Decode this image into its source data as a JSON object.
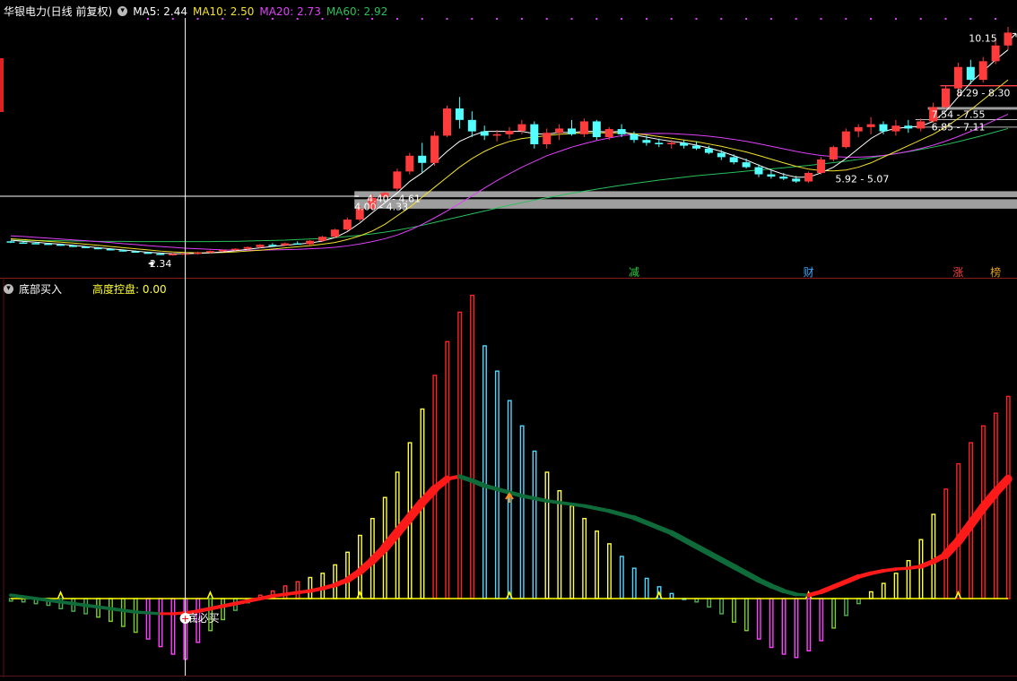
{
  "header": {
    "title": "华银电力(日线 前复权)",
    "ma5_label": "MA5:",
    "ma5_value": "2.44",
    "ma10_label": "MA10:",
    "ma10_value": "2.50",
    "ma20_label": "MA20:",
    "ma20_value": "2.73",
    "ma60_label": "MA60:",
    "ma60_value": "2.92"
  },
  "indicator_header": {
    "name": "底部买入",
    "param_label": "高度控盘:",
    "param_value": "0.00"
  },
  "price_annotations": [
    {
      "text": "10.15"
    },
    {
      "text": "8.29 - 8.30"
    },
    {
      "text": "7.54 - 7.55"
    },
    {
      "text": "6.85 - 7.11"
    },
    {
      "text": "5.92 - 5.07"
    },
    {
      "text": "4.40 - 4.61"
    },
    {
      "text": "4.00 - 4.33"
    },
    {
      "text": "2.34"
    }
  ],
  "event_tags": [
    {
      "text": "减",
      "color": "#2ecc40"
    },
    {
      "text": "财",
      "color": "#3fa7ff"
    },
    {
      "text": "涨",
      "color": "#ff4040"
    },
    {
      "text": "榜",
      "color": "#e0a020"
    }
  ],
  "indicator_markers": {
    "buy_label": "底必买",
    "buy_symbol": "+"
  },
  "colors": {
    "up": "#ff3b3b",
    "down": "#54ffff",
    "ma5": "#ffffff",
    "ma10": "#f2e12b",
    "ma20": "#e040fb",
    "ma60": "#28c05a",
    "crosshair": "#ffffff",
    "zone": "#9e9e9e",
    "ribbon_up": "#ff1a1a",
    "ribbon_down": "#0f6b3a",
    "baseline": "#ffff00"
  },
  "chart_data": {
    "type": "candlestick",
    "candles": [
      [
        2.86,
        2.88,
        2.8,
        2.82
      ],
      [
        2.82,
        2.85,
        2.78,
        2.8
      ],
      [
        2.8,
        2.84,
        2.77,
        2.78
      ],
      [
        2.78,
        2.8,
        2.74,
        2.75
      ],
      [
        2.75,
        2.78,
        2.7,
        2.71
      ],
      [
        2.71,
        2.74,
        2.66,
        2.67
      ],
      [
        2.67,
        2.7,
        2.62,
        2.63
      ],
      [
        2.63,
        2.66,
        2.58,
        2.59
      ],
      [
        2.59,
        2.62,
        2.54,
        2.55
      ],
      [
        2.55,
        2.58,
        2.5,
        2.51
      ],
      [
        2.51,
        2.54,
        2.46,
        2.47
      ],
      [
        2.47,
        2.5,
        2.42,
        2.43
      ],
      [
        2.43,
        2.47,
        2.38,
        2.4
      ],
      [
        2.4,
        2.45,
        2.36,
        2.42
      ],
      [
        2.42,
        2.48,
        2.34,
        2.44
      ],
      [
        2.44,
        2.5,
        2.4,
        2.47
      ],
      [
        2.47,
        2.54,
        2.44,
        2.52
      ],
      [
        2.52,
        2.58,
        2.49,
        2.56
      ],
      [
        2.56,
        2.62,
        2.52,
        2.6
      ],
      [
        2.6,
        2.68,
        2.57,
        2.66
      ],
      [
        2.66,
        2.76,
        2.62,
        2.74
      ],
      [
        2.74,
        2.8,
        2.68,
        2.72
      ],
      [
        2.72,
        2.82,
        2.69,
        2.79
      ],
      [
        2.79,
        2.86,
        2.74,
        2.76
      ],
      [
        2.76,
        2.9,
        2.72,
        2.88
      ],
      [
        2.88,
        3.05,
        2.84,
        3.02
      ],
      [
        3.02,
        3.3,
        2.98,
        3.27
      ],
      [
        3.27,
        3.7,
        3.22,
        3.62
      ],
      [
        3.62,
        4.1,
        3.55,
        4.0
      ],
      [
        4.0,
        4.5,
        3.95,
        4.38
      ],
      [
        4.42,
        4.6,
        4.38,
        4.55
      ],
      [
        4.7,
        5.4,
        4.62,
        5.3
      ],
      [
        5.3,
        5.95,
        5.2,
        5.85
      ],
      [
        5.85,
        6.3,
        5.25,
        5.6
      ],
      [
        5.6,
        6.7,
        5.5,
        6.55
      ],
      [
        6.55,
        7.6,
        6.5,
        7.5
      ],
      [
        7.5,
        7.9,
        6.8,
        7.1
      ],
      [
        7.1,
        7.4,
        6.5,
        6.7
      ],
      [
        6.7,
        6.9,
        6.4,
        6.55
      ],
      [
        6.55,
        6.75,
        6.35,
        6.6
      ],
      [
        6.6,
        6.85,
        6.45,
        6.72
      ],
      [
        6.72,
        7.1,
        6.6,
        6.95
      ],
      [
        6.95,
        7.05,
        6.1,
        6.25
      ],
      [
        6.25,
        6.8,
        6.1,
        6.65
      ],
      [
        6.65,
        6.95,
        6.4,
        6.8
      ],
      [
        6.8,
        7.1,
        6.55,
        6.6
      ],
      [
        6.6,
        7.15,
        6.5,
        7.05
      ],
      [
        7.05,
        7.1,
        6.4,
        6.5
      ],
      [
        6.5,
        6.85,
        6.4,
        6.78
      ],
      [
        6.78,
        6.95,
        6.5,
        6.6
      ],
      [
        6.6,
        6.7,
        6.3,
        6.4
      ],
      [
        6.4,
        6.55,
        6.2,
        6.3
      ],
      [
        6.3,
        6.45,
        6.15,
        6.25
      ],
      [
        6.25,
        6.4,
        6.1,
        6.3
      ],
      [
        6.3,
        6.4,
        6.1,
        6.2
      ],
      [
        6.2,
        6.35,
        6.05,
        6.1
      ],
      [
        6.1,
        6.2,
        5.9,
        5.95
      ],
      [
        5.95,
        6.05,
        5.7,
        5.8
      ],
      [
        5.8,
        5.9,
        5.55,
        5.62
      ],
      [
        5.62,
        5.75,
        5.4,
        5.45
      ],
      [
        5.45,
        5.55,
        5.1,
        5.2
      ],
      [
        5.2,
        5.35,
        5.05,
        5.12
      ],
      [
        5.12,
        5.25,
        5.0,
        5.05
      ],
      [
        5.05,
        5.15,
        4.9,
        4.95
      ],
      [
        4.95,
        5.3,
        4.9,
        5.25
      ],
      [
        5.25,
        5.8,
        5.2,
        5.72
      ],
      [
        5.72,
        6.2,
        5.65,
        6.15
      ],
      [
        6.15,
        6.8,
        6.1,
        6.7
      ],
      [
        6.7,
        6.95,
        6.5,
        6.85
      ],
      [
        6.85,
        7.2,
        6.6,
        6.95
      ],
      [
        6.95,
        7.05,
        6.6,
        6.7
      ],
      [
        6.7,
        7.1,
        6.55,
        6.9
      ],
      [
        6.9,
        7.1,
        6.65,
        6.8
      ],
      [
        6.8,
        7.15,
        6.7,
        7.05
      ],
      [
        7.05,
        7.7,
        7.0,
        7.55
      ],
      [
        7.55,
        8.3,
        7.5,
        8.2
      ],
      [
        8.2,
        9.1,
        7.9,
        8.95
      ],
      [
        8.95,
        9.2,
        8.35,
        8.5
      ],
      [
        8.5,
        9.3,
        8.4,
        9.15
      ],
      [
        9.15,
        9.9,
        9.05,
        9.7
      ],
      [
        9.7,
        10.35,
        9.55,
        10.15
      ]
    ],
    "ma5": [
      2.9,
      2.86,
      2.83,
      2.79,
      2.76,
      2.72,
      2.68,
      2.64,
      2.6,
      2.56,
      2.52,
      2.48,
      2.45,
      2.43,
      2.43,
      2.44,
      2.46,
      2.49,
      2.53,
      2.58,
      2.63,
      2.68,
      2.72,
      2.76,
      2.8,
      2.87,
      2.99,
      3.2,
      3.5,
      3.86,
      4.2,
      4.55,
      4.95,
      5.25,
      5.6,
      6.0,
      6.35,
      6.55,
      6.7,
      6.7,
      6.7,
      6.7,
      6.62,
      6.6,
      6.67,
      6.66,
      6.7,
      6.7,
      6.68,
      6.7,
      6.58,
      6.5,
      6.42,
      6.35,
      6.3,
      6.22,
      6.12,
      6.0,
      5.85,
      5.7,
      5.52,
      5.35,
      5.2,
      5.1,
      5.1,
      5.25,
      5.45,
      5.75,
      6.1,
      6.45,
      6.7,
      6.8,
      6.85,
      6.88,
      7.05,
      7.4,
      7.9,
      8.4,
      8.8,
      9.2,
      9.55
    ],
    "ma10": [
      2.95,
      2.92,
      2.89,
      2.86,
      2.83,
      2.8,
      2.76,
      2.72,
      2.68,
      2.64,
      2.6,
      2.56,
      2.52,
      2.49,
      2.47,
      2.46,
      2.46,
      2.47,
      2.49,
      2.52,
      2.55,
      2.59,
      2.63,
      2.67,
      2.71,
      2.76,
      2.82,
      2.92,
      3.05,
      3.22,
      3.45,
      3.75,
      4.05,
      4.4,
      4.75,
      5.1,
      5.45,
      5.75,
      6.0,
      6.2,
      6.35,
      6.45,
      6.5,
      6.55,
      6.6,
      6.62,
      6.65,
      6.65,
      6.65,
      6.65,
      6.62,
      6.58,
      6.52,
      6.46,
      6.4,
      6.34,
      6.26,
      6.18,
      6.08,
      5.98,
      5.86,
      5.73,
      5.6,
      5.48,
      5.38,
      5.33,
      5.32,
      5.35,
      5.45,
      5.6,
      5.8,
      6.0,
      6.2,
      6.4,
      6.6,
      6.85,
      7.15,
      7.45,
      7.8,
      8.15,
      8.5
    ],
    "ma20": [
      3.05,
      3.03,
      3.0,
      2.97,
      2.94,
      2.91,
      2.88,
      2.85,
      2.82,
      2.78,
      2.75,
      2.71,
      2.68,
      2.65,
      2.62,
      2.6,
      2.58,
      2.56,
      2.55,
      2.55,
      2.55,
      2.56,
      2.57,
      2.58,
      2.6,
      2.62,
      2.65,
      2.7,
      2.77,
      2.85,
      2.95,
      3.08,
      3.25,
      3.45,
      3.68,
      3.92,
      4.18,
      4.45,
      4.72,
      4.98,
      5.22,
      5.45,
      5.65,
      5.85,
      6.0,
      6.15,
      6.27,
      6.38,
      6.47,
      6.55,
      6.6,
      6.62,
      6.63,
      6.62,
      6.6,
      6.57,
      6.53,
      6.48,
      6.42,
      6.35,
      6.27,
      6.18,
      6.09,
      6.0,
      5.92,
      5.86,
      5.82,
      5.8,
      5.8,
      5.82,
      5.86,
      5.92,
      6.0,
      6.1,
      6.22,
      6.36,
      6.52,
      6.7,
      6.9,
      7.1,
      7.3
    ],
    "ma60": [
      2.9,
      2.89,
      2.89,
      2.88,
      2.88,
      2.87,
      2.87,
      2.86,
      2.86,
      2.86,
      2.85,
      2.85,
      2.85,
      2.85,
      2.85,
      2.85,
      2.85,
      2.86,
      2.86,
      2.87,
      2.88,
      2.89,
      2.9,
      2.92,
      2.94,
      2.96,
      2.99,
      3.03,
      3.07,
      3.12,
      3.18,
      3.25,
      3.33,
      3.42,
      3.52,
      3.62,
      3.72,
      3.82,
      3.92,
      4.02,
      4.12,
      4.21,
      4.3,
      4.38,
      4.46,
      4.54,
      4.61,
      4.68,
      4.75,
      4.82,
      4.88,
      4.94,
      5.0,
      5.05,
      5.1,
      5.15,
      5.19,
      5.23,
      5.27,
      5.31,
      5.35,
      5.39,
      5.43,
      5.47,
      5.51,
      5.56,
      5.61,
      5.66,
      5.72,
      5.78,
      5.85,
      5.92,
      5.99,
      6.07,
      6.15,
      6.24,
      6.34,
      6.45,
      6.56,
      6.68,
      6.8
    ],
    "indicator_bars": [
      -3,
      -4,
      -6,
      -8,
      -12,
      -15,
      -18,
      -22,
      -27,
      -33,
      -40,
      -48,
      -57,
      -66,
      -72,
      -52,
      -38,
      -25,
      -14,
      -5,
      4,
      9,
      15,
      20,
      25,
      30,
      40,
      55,
      75,
      95,
      120,
      150,
      185,
      225,
      265,
      305,
      340,
      360,
      300,
      270,
      235,
      205,
      175,
      150,
      128,
      110,
      95,
      80,
      65,
      50,
      36,
      24,
      14,
      6,
      0,
      -4,
      -10,
      -18,
      -28,
      -38,
      -48,
      -58,
      -66,
      -70,
      -62,
      -50,
      -35,
      -20,
      -6,
      8,
      18,
      30,
      45,
      70,
      100,
      130,
      160,
      185,
      205,
      220,
      240
    ],
    "indicator_ribbon": [
      4,
      2,
      0,
      -2,
      -4,
      -6,
      -8,
      -10,
      -12,
      -14,
      -16,
      -17,
      -18,
      -18,
      -17,
      -15,
      -12,
      -9,
      -6,
      -3,
      0,
      3,
      5,
      7,
      9,
      12,
      16,
      22,
      32,
      45,
      60,
      78,
      96,
      114,
      130,
      142,
      145,
      140,
      134,
      130,
      126,
      122,
      119,
      116,
      114,
      112,
      110,
      107,
      104,
      100,
      96,
      90,
      84,
      78,
      70,
      62,
      54,
      46,
      38,
      30,
      22,
      15,
      9,
      5,
      4,
      8,
      14,
      20,
      26,
      30,
      33,
      35,
      36,
      38,
      44,
      52,
      68,
      88,
      108,
      126,
      142
    ],
    "baseline_value": 0
  }
}
